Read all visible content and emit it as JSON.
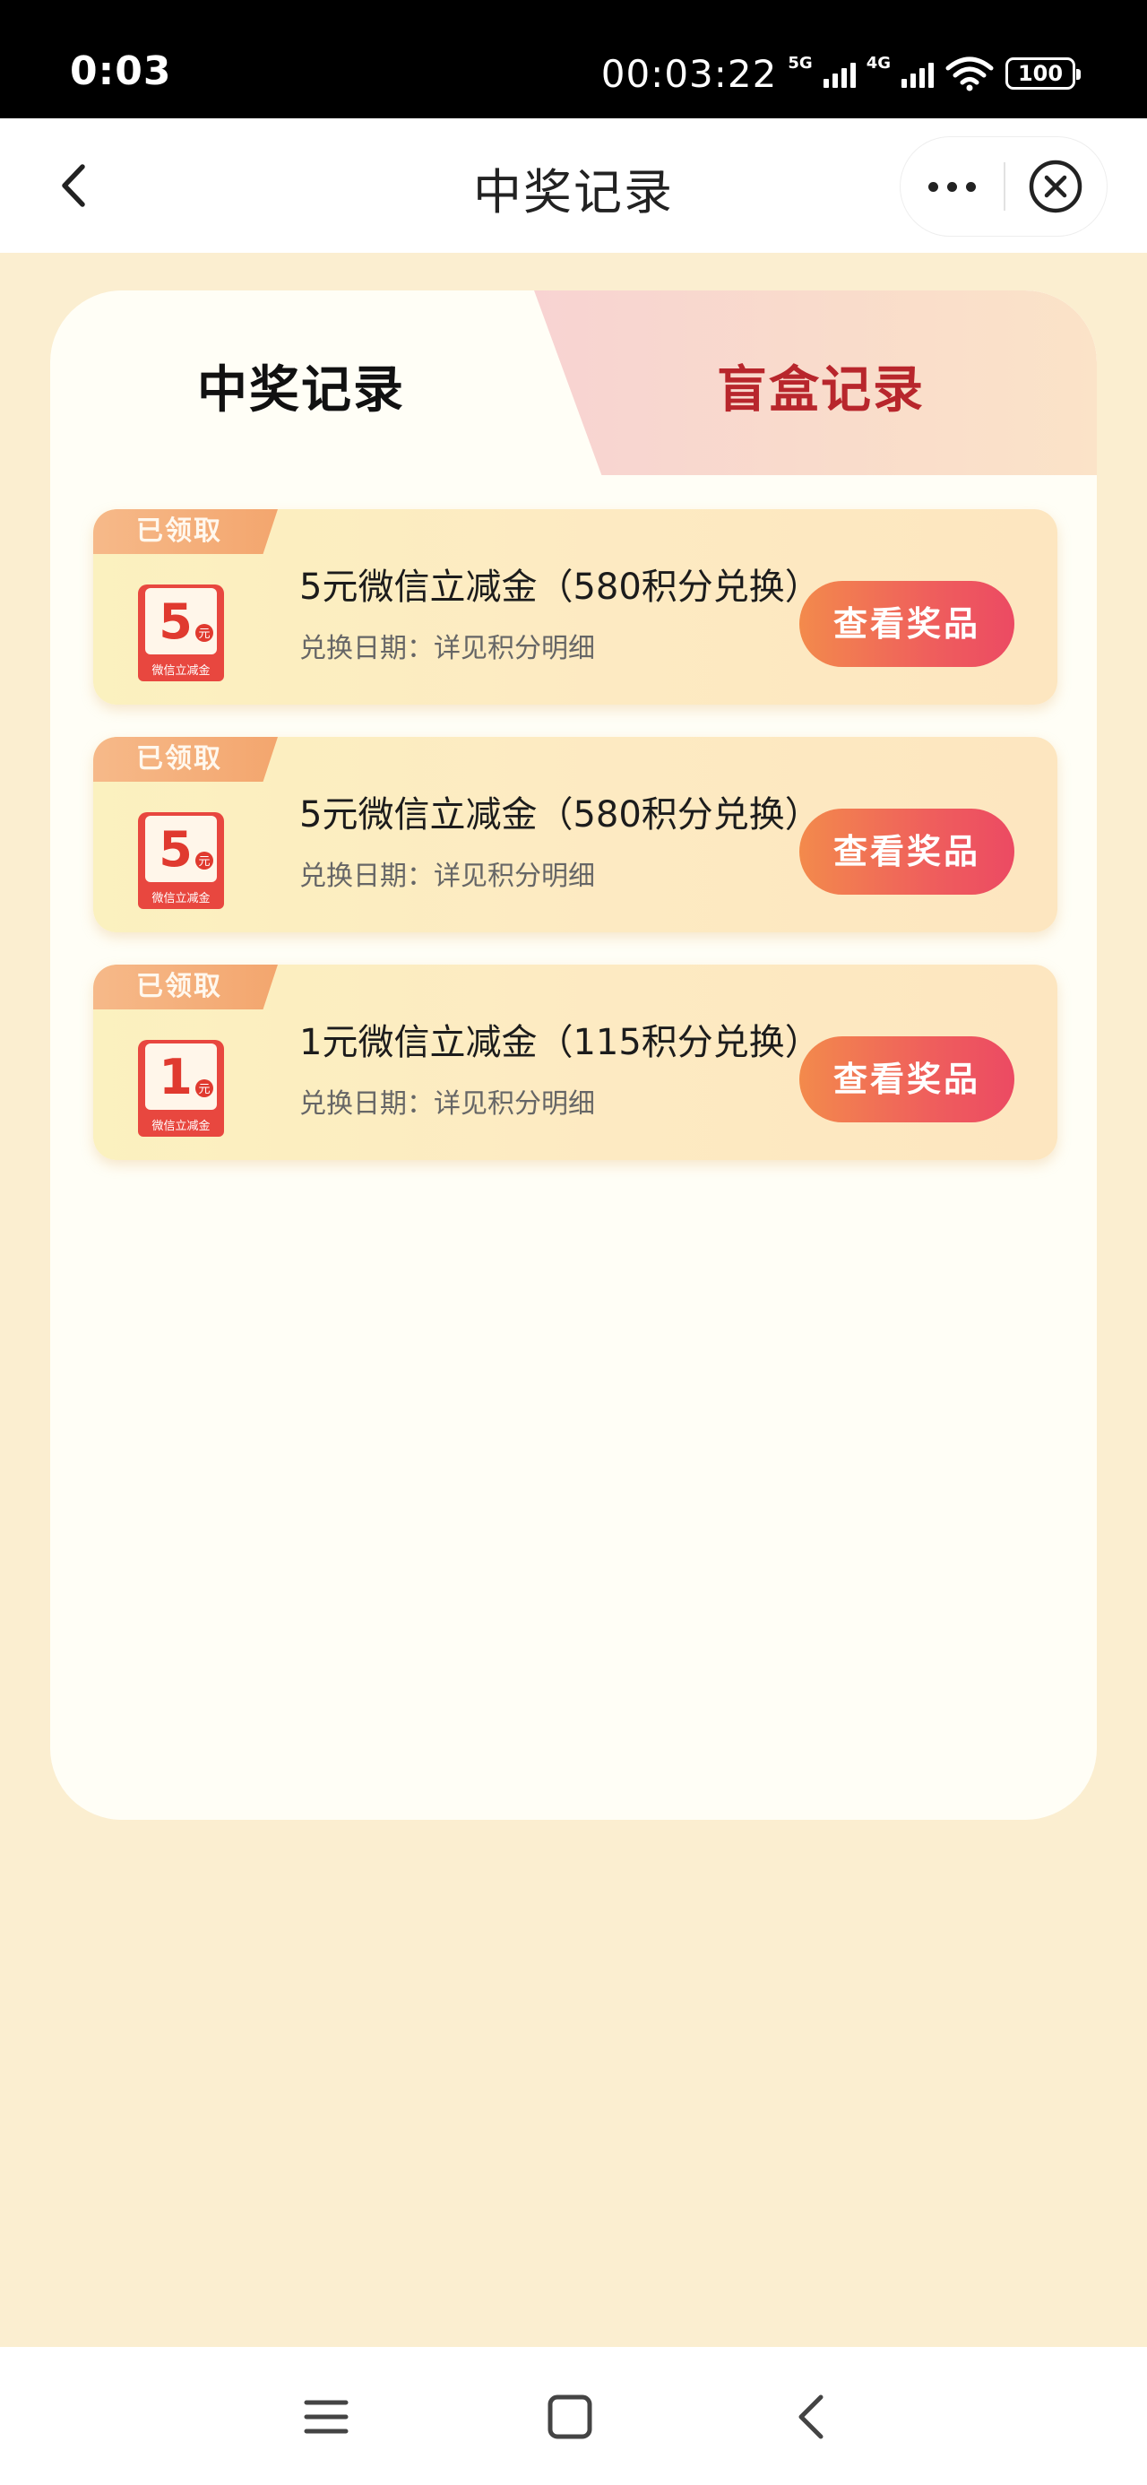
{
  "status_bar": {
    "time": "0:03",
    "clock": "00:03:22",
    "network_1": "5G",
    "network_2": "4G",
    "battery": "100"
  },
  "nav": {
    "title": "中奖记录"
  },
  "tabs": [
    {
      "label": "中奖记录",
      "active": true
    },
    {
      "label": "盲盒记录",
      "active": false
    }
  ],
  "records": [
    {
      "badge": "已领取",
      "icon_amount": "5",
      "icon_unit": "元",
      "icon_caption": "微信立减金",
      "title": "5元微信立减金（580积分兑换）",
      "subtitle": "兑换日期：详见积分明细",
      "button": "查看奖品"
    },
    {
      "badge": "已领取",
      "icon_amount": "5",
      "icon_unit": "元",
      "icon_caption": "微信立减金",
      "title": "5元微信立减金（580积分兑换）",
      "subtitle": "兑换日期：详见积分明细",
      "button": "查看奖品"
    },
    {
      "badge": "已领取",
      "icon_amount": "1",
      "icon_unit": "元",
      "icon_caption": "微信立减金",
      "title": "1元微信立减金（115积分兑换）",
      "subtitle": "兑换日期：详见积分明细",
      "button": "查看奖品"
    }
  ],
  "colors": {
    "page_bg": "#fbeed0",
    "active_tab_text": "#111111",
    "inactive_tab_text": "#b8262c",
    "button_gradient_start": "#f38a4c",
    "button_gradient_end": "#ec4a63"
  },
  "icons": [
    "back-arrow-icon",
    "more-dots-icon",
    "close-circle-icon",
    "coupon-icon",
    "menu-icon",
    "home-square-icon",
    "back-chevron-icon"
  ]
}
